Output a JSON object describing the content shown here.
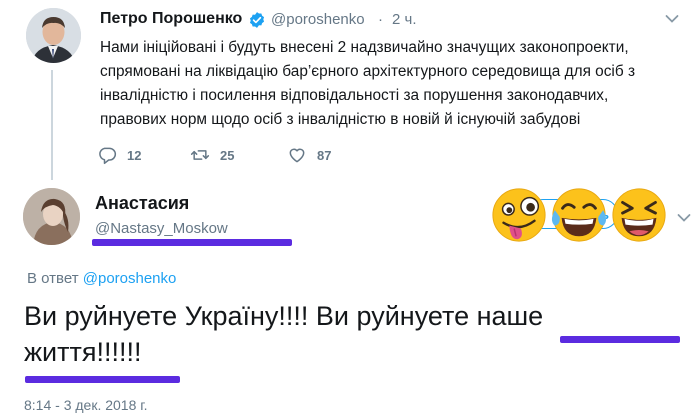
{
  "tweet": {
    "author_name": "Петро Порошенко",
    "author_handle": "@poroshenko",
    "separator": "·",
    "time": "2 ч.",
    "text_lines": [
      "Нами ініційовані і будуть внесені 2 надзвичайно значущих законопроекти,",
      "спрямовані на ліквідацію бар’єрного архітектурного середовища для осіб з",
      "інвалідністю і посилення відповідальності за порушення законодавчих,",
      "правових норм щодо осіб з інвалідністю в новій й існуючій забудові"
    ],
    "actions": {
      "replies": "12",
      "retweets": "25",
      "likes": "87"
    }
  },
  "reply": {
    "author_name": "Анастасия",
    "author_handle": "@Nastasy_Moskow",
    "follow_label": "ать",
    "in_reply_prefix": "В ответ",
    "in_reply_handle": "@poroshenko",
    "text_lines": [
      "Ви руйнуете Україну!!!! Ви руйнуете наше",
      "життя!!!!!!"
    ],
    "timestamp": "8:14 - 3 дек. 2018 г."
  },
  "icons": {
    "verified": "verified-badge-icon",
    "reply": "reply-icon",
    "retweet": "retweet-icon",
    "like": "heart-icon",
    "more": "chevron-down-icon",
    "emojis": [
      "zany-face-emoji",
      "tears-of-joy-emoji",
      "grinning-squinting-face-emoji"
    ]
  },
  "colors": {
    "text": "#14171a",
    "muted": "#657786",
    "link": "#1da1f2",
    "highlight_underline": "#5b2be0",
    "thread_line": "#ccd6dd"
  }
}
